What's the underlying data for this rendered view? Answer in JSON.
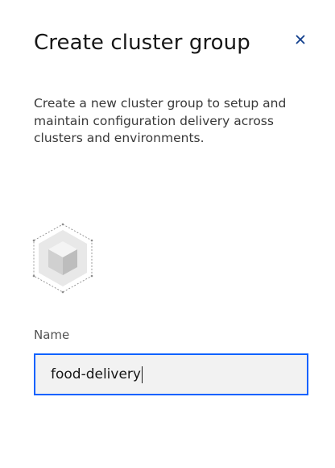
{
  "dialog": {
    "title": "Create cluster group",
    "close_icon": "close-icon",
    "description_lines": [
      "Create a new cluster group to setup and",
      "maintain configuration delivery across",
      "clusters and environments."
    ],
    "illustration_icon": "cluster-cube-icon"
  },
  "form": {
    "name_label": "Name",
    "name_value": "food-delivery"
  },
  "colors": {
    "focus_border": "#0f62fe",
    "input_background": "#f2f2f2",
    "close_icon": "#0f3d8c"
  }
}
